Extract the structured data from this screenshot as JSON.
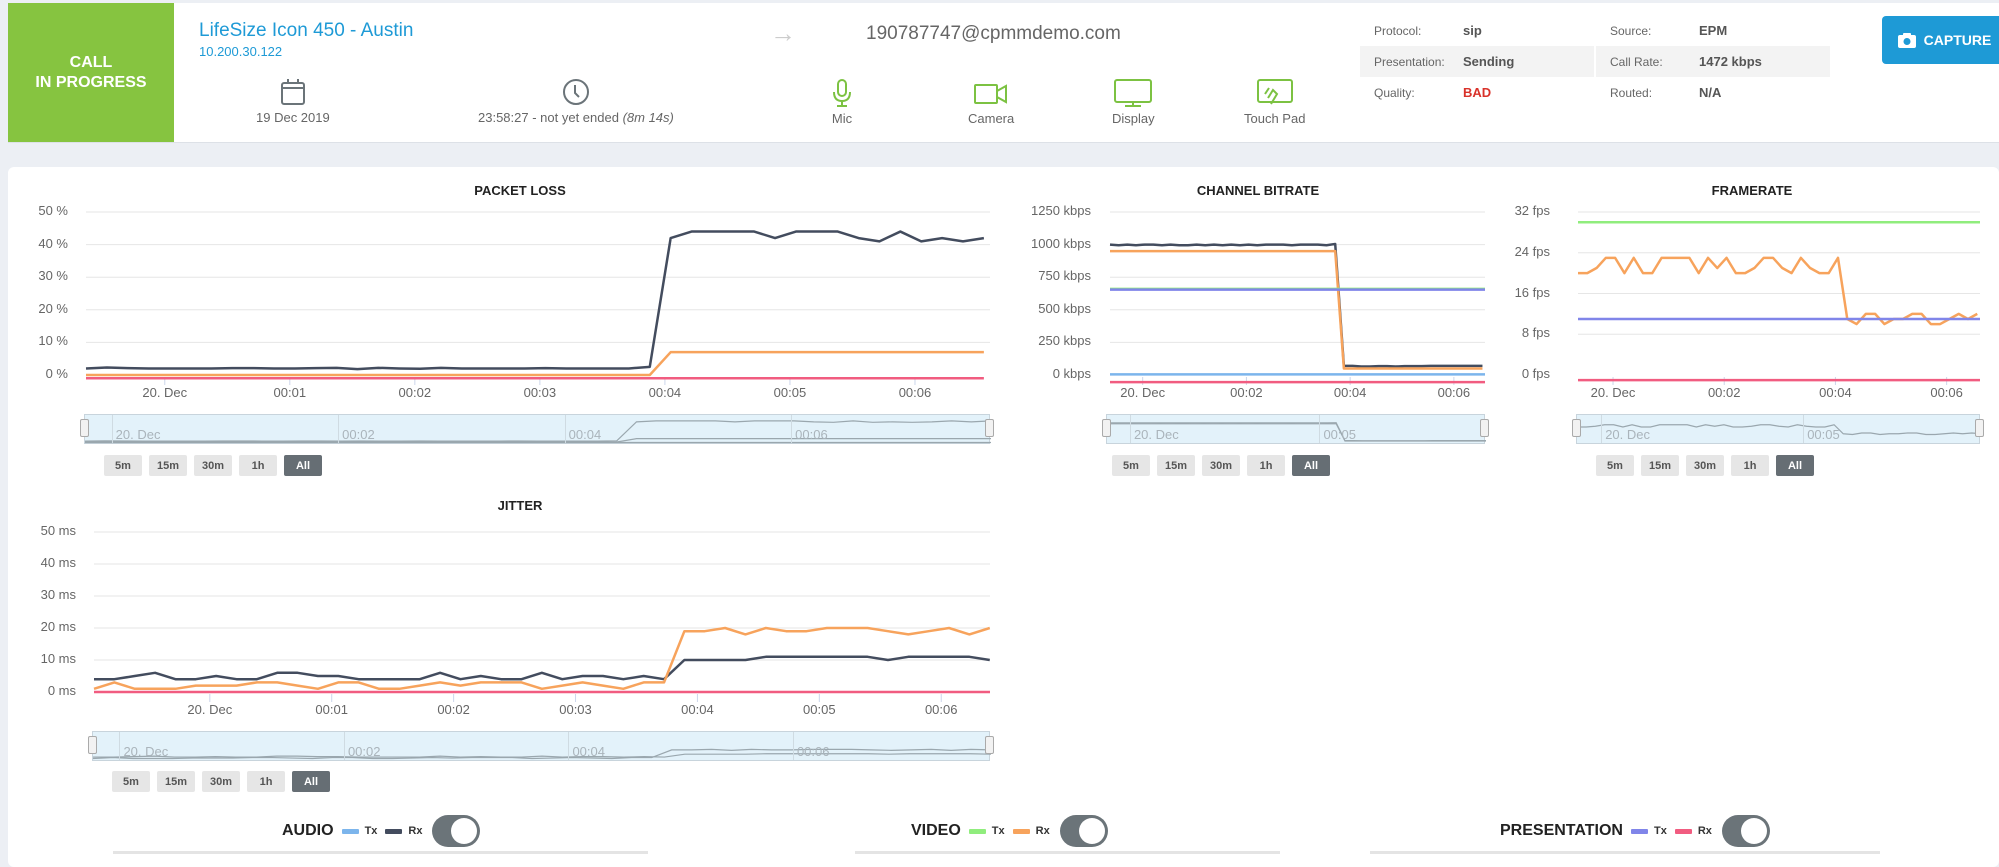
{
  "header": {
    "status_line1": "CALL",
    "status_line2": "IN PROGRESS",
    "device_name": "LifeSize Icon 450 - Austin",
    "device_ip": "10.200.30.122",
    "date": "19 Dec 2019",
    "time_start": "23:58:27 - not yet ended",
    "duration": "(8m 14s)",
    "remote_party": "190787747@cpmmdemo.com",
    "peripherals": [
      {
        "label": "Mic",
        "icon": "mic-icon"
      },
      {
        "label": "Camera",
        "icon": "camera-icon"
      },
      {
        "label": "Display",
        "icon": "display-icon"
      },
      {
        "label": "Touch Pad",
        "icon": "touchpad-icon"
      }
    ],
    "info": {
      "protocol_label": "Protocol:",
      "protocol": "sip",
      "source_label": "Source:",
      "source": "EPM",
      "presentation_label": "Presentation:",
      "presentation": "Sending",
      "call_rate_label": "Call Rate:",
      "call_rate": "1472 kbps",
      "quality_label": "Quality:",
      "quality": "BAD",
      "routed_label": "Routed:",
      "routed": "N/A"
    },
    "capture_label": "CAPTURE"
  },
  "colors": {
    "status_green": "#86c440",
    "accent_blue": "#1e9ad6",
    "audio_tx": "#7cb5ec",
    "audio_rx": "#434c5e",
    "video_tx": "#90ed7d",
    "video_rx": "#f7a35c",
    "pres_tx": "#8085e9",
    "pres_rx": "#f15c80",
    "bad_red": "#d9322a"
  },
  "range_buttons": [
    "5m",
    "15m",
    "30m",
    "1h",
    "All"
  ],
  "range_selected": "All",
  "legend": {
    "audio": {
      "title": "AUDIO",
      "tx": "Tx",
      "rx": "Rx",
      "enabled": true
    },
    "video": {
      "title": "VIDEO",
      "tx": "Tx",
      "rx": "Rx",
      "enabled": true
    },
    "presentation": {
      "title": "PRESENTATION",
      "tx": "Tx",
      "rx": "Rx",
      "enabled": true
    }
  },
  "chart_data": [
    {
      "id": "packet_loss",
      "type": "line",
      "title": "PACKET LOSS",
      "ylim": [
        0,
        50
      ],
      "yticks": [
        "50 %",
        "40 %",
        "30 %",
        "20 %",
        "10 %",
        "0 %"
      ],
      "xticks": [
        "20. Dec",
        "00:01",
        "00:02",
        "00:03",
        "00:04",
        "00:05",
        "00:06"
      ],
      "xlim_min": [
        -0.63,
        6.6
      ],
      "xtick_pos_min": [
        0,
        1,
        2,
        3,
        4,
        5,
        6
      ],
      "navigator_labels": [
        "20. Dec",
        "00:02",
        "00:04",
        "00:06"
      ],
      "series": [
        {
          "name": "Audio Rx",
          "color": "#434c5e",
          "x_step_min": 0.167,
          "x_start_min": -0.63,
          "values": [
            2,
            2.3,
            2.1,
            2,
            2,
            2,
            2,
            2.1,
            2.1,
            2,
            2,
            2.1,
            2.2,
            1.8,
            2.2,
            2,
            1.9,
            2.2,
            2,
            2,
            2,
            2,
            2.1,
            2,
            2,
            2,
            2,
            2.5,
            42,
            44,
            44,
            44,
            44,
            42,
            44,
            44,
            44,
            42,
            41,
            44,
            41,
            42,
            41,
            42,
            44,
            42,
            44
          ]
        },
        {
          "name": "Video Rx",
          "color": "#f7a35c",
          "x_step_min": 0.167,
          "x_start_min": -0.63,
          "values": [
            0,
            0,
            0,
            0,
            0,
            0,
            0,
            0,
            0,
            0,
            0,
            0,
            0,
            0,
            0,
            0,
            0,
            0,
            0,
            0,
            0,
            0,
            0,
            0,
            0,
            0,
            0,
            0,
            7,
            7,
            7,
            7,
            7,
            7,
            7,
            7,
            7,
            7,
            7,
            7,
            7,
            7,
            7,
            7,
            7,
            7,
            7
          ]
        },
        {
          "name": "Presentation Rx",
          "color": "#f15c80",
          "x_step_min": 0.167,
          "x_start_min": -0.63,
          "values": [
            -1,
            -1,
            -1,
            -1,
            -1,
            -1,
            -1,
            -1,
            -1,
            -1,
            -1,
            -1,
            -1,
            -1,
            -1,
            -1,
            -1,
            -1,
            -1,
            -1,
            -1,
            -1,
            -1,
            -1,
            -1,
            -1,
            -1,
            -1,
            -1,
            -1,
            -1,
            -1,
            -1,
            -1,
            -1,
            -1,
            -1,
            -1,
            -1,
            -1,
            -1,
            -1,
            -1,
            -1,
            -1,
            -1,
            -1
          ]
        }
      ]
    },
    {
      "id": "channel_bitrate",
      "type": "line",
      "title": "CHANNEL BITRATE",
      "ylim": [
        0,
        1250
      ],
      "yticks": [
        "1250 kbps",
        "1000 kbps",
        "750 kbps",
        "500 kbps",
        "250 kbps",
        "0 kbps"
      ],
      "xticks": [
        "20. Dec",
        "00:02",
        "00:04",
        "00:06"
      ],
      "xlim_min": [
        -0.63,
        6.6
      ],
      "xtick_pos_min": [
        0,
        2,
        4,
        6
      ],
      "navigator_labels": [
        "20. Dec",
        "00:05"
      ],
      "series": [
        {
          "name": "Audio Rx",
          "color": "#434c5e",
          "x_step_min": 0.167,
          "x_start_min": -0.63,
          "values": [
            1000,
            995,
            1000,
            995,
            1000,
            1000,
            995,
            1000,
            995,
            995,
            1000,
            995,
            1000,
            995,
            1000,
            995,
            1000,
            995,
            1000,
            1000,
            1000,
            995,
            1000,
            1000,
            1000,
            995,
            1005,
            70,
            70,
            65,
            65,
            68,
            68,
            65,
            68,
            68,
            68,
            70,
            70,
            70,
            70,
            70,
            70,
            70
          ]
        },
        {
          "name": "Video Rx",
          "color": "#f7a35c",
          "x_step_min": 0.167,
          "x_start_min": -0.63,
          "values": [
            950,
            950,
            950,
            950,
            950,
            950,
            950,
            950,
            950,
            950,
            950,
            950,
            950,
            950,
            950,
            950,
            950,
            950,
            950,
            950,
            950,
            950,
            950,
            950,
            950,
            950,
            950,
            50,
            50,
            50,
            50,
            50,
            50,
            50,
            50,
            50,
            50,
            50,
            50,
            50,
            50,
            50,
            50,
            50
          ]
        },
        {
          "name": "Video Tx",
          "color": "#90ed7d",
          "constant": 660
        },
        {
          "name": "Presentation Tx",
          "color": "#8085e9",
          "constant": 655
        },
        {
          "name": "Audio Tx",
          "color": "#7cb5ec",
          "constant": 5
        },
        {
          "name": "Presentation Rx",
          "color": "#f15c80",
          "constant": -55
        }
      ]
    },
    {
      "id": "framerate",
      "type": "line",
      "title": "FRAMERATE",
      "ylim": [
        0,
        32
      ],
      "yticks": [
        "32 fps",
        "24 fps",
        "16 fps",
        "8 fps",
        "0 fps"
      ],
      "xticks": [
        "20. Dec",
        "00:02",
        "00:04",
        "00:06"
      ],
      "xlim_min": [
        -0.63,
        6.6
      ],
      "xtick_pos_min": [
        0,
        2,
        4,
        6
      ],
      "navigator_labels": [
        "20. Dec",
        "00:05"
      ],
      "series": [
        {
          "name": "Video Tx",
          "color": "#90ed7d",
          "constant": 30
        },
        {
          "name": "Video Rx",
          "color": "#f7a35c",
          "x_step_min": 0.167,
          "x_start_min": -0.63,
          "values": [
            20,
            20,
            21,
            23,
            23,
            20,
            23,
            20,
            20,
            23,
            23,
            23,
            23,
            20,
            23,
            21,
            23,
            20,
            20,
            21,
            23,
            23,
            21,
            20,
            23,
            21,
            20,
            20,
            23,
            11,
            10,
            12,
            12,
            10,
            11,
            11,
            12,
            12,
            10,
            10,
            11,
            12,
            11,
            12,
            11
          ]
        },
        {
          "name": "Presentation Tx",
          "color": "#8085e9",
          "constant": 11
        },
        {
          "name": "Presentation Rx",
          "color": "#f15c80",
          "constant": -1
        }
      ]
    },
    {
      "id": "jitter",
      "type": "line",
      "title": "JITTER",
      "ylim": [
        0,
        50
      ],
      "yticks": [
        "50 ms",
        "40 ms",
        "30 ms",
        "20 ms",
        "10 ms",
        "0 ms"
      ],
      "xticks": [
        "20. Dec",
        "00:01",
        "00:02",
        "00:03",
        "00:04",
        "00:05",
        "00:06"
      ],
      "xlim_min": [
        -0.95,
        6.4
      ],
      "xtick_pos_min": [
        0,
        1,
        2,
        3,
        4,
        5,
        6
      ],
      "navigator_labels": [
        "20. Dec",
        "00:02",
        "00:04",
        "00:06"
      ],
      "series": [
        {
          "name": "Audio Rx",
          "color": "#434c5e",
          "x_step_min": 0.167,
          "x_start_min": -0.95,
          "values": [
            4,
            4,
            5,
            6,
            4,
            4,
            5,
            4,
            4,
            6,
            6,
            5,
            5,
            4,
            4,
            4,
            4,
            6,
            4,
            5,
            4,
            4,
            6,
            4,
            5,
            5,
            4,
            5,
            4,
            10,
            10,
            10,
            10,
            11,
            11,
            11,
            11,
            11,
            11,
            10,
            11,
            11,
            11,
            11,
            10
          ]
        },
        {
          "name": "Video Rx",
          "color": "#f7a35c",
          "x_step_min": 0.167,
          "x_start_min": -0.95,
          "values": [
            1,
            3,
            1,
            1,
            1,
            2,
            2,
            2,
            3,
            3,
            2,
            1,
            3,
            3,
            1,
            1,
            2,
            3,
            2,
            3,
            3,
            3,
            1,
            2,
            3,
            2,
            1,
            3,
            3,
            19,
            19,
            20,
            18,
            20,
            19,
            19,
            20,
            20,
            20,
            19,
            18,
            19,
            20,
            18,
            20,
            19
          ]
        },
        {
          "name": "Presentation Rx",
          "color": "#f15c80",
          "constant": 0
        }
      ]
    }
  ]
}
